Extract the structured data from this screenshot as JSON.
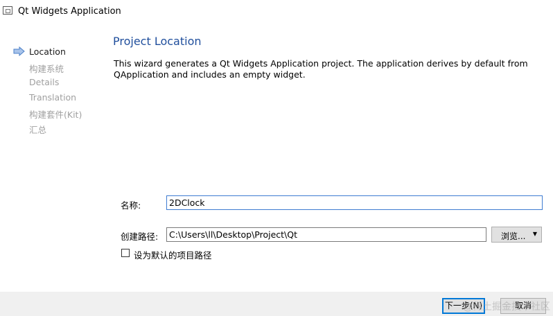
{
  "window": {
    "title": "Qt Widgets Application"
  },
  "sidebar": {
    "steps": [
      {
        "label": "Location",
        "active": true
      },
      {
        "label": "构建系统",
        "active": false
      },
      {
        "label": "Details",
        "active": false
      },
      {
        "label": "Translation",
        "active": false
      },
      {
        "label": "构建套件(Kit)",
        "active": false
      },
      {
        "label": "汇总",
        "active": false
      }
    ],
    "active_icon": "arrow-right-icon"
  },
  "main": {
    "heading": "Project Location",
    "description": "This wizard generates a Qt Widgets Application project. The application derives by default from QApplication and includes an empty widget.",
    "name_label": "名称:",
    "name_value": "2DClock",
    "path_label": "创建路径:",
    "path_value": "C:\\Users\\ll\\Desktop\\Project\\Qt",
    "browse_label": "浏览...",
    "default_path_checkbox": {
      "label": "设为默认的项目路径",
      "checked": false
    }
  },
  "footer": {
    "next_label": "下一步(N)",
    "cancel_label": "取消"
  },
  "watermark": "@稀土掘金技术社区",
  "colors": {
    "heading": "#1f4e9c",
    "accent": "#0078d7",
    "focus": "#3d7bd1"
  }
}
